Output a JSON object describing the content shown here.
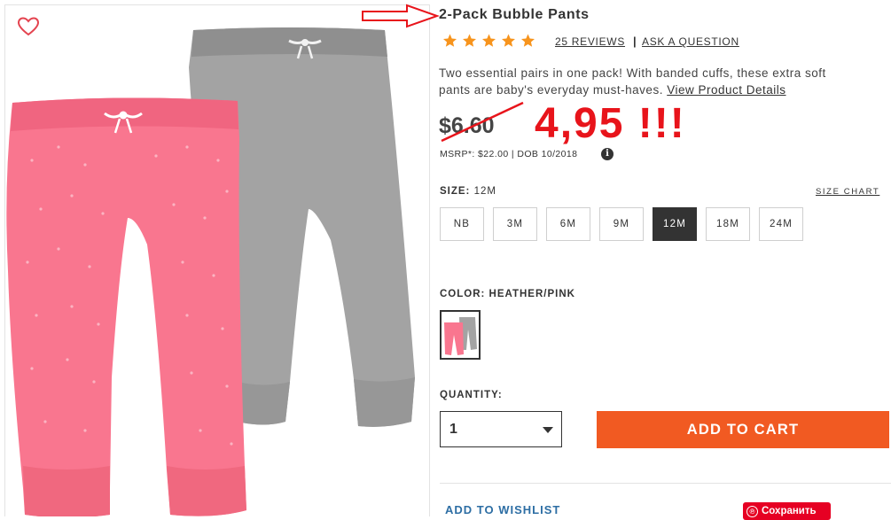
{
  "product": {
    "title": "2-Pack Bubble Pants",
    "rating_stars": 5,
    "reviews_link": "25 REVIEWS",
    "separator": "|",
    "ask_link": "ASK A QUESTION",
    "description": "Two essential pairs in one pack! With banded cuffs, these extra soft pants are baby's everyday must-haves.",
    "details_link": "View Product Details"
  },
  "price": {
    "old": "$6.60",
    "new": "4,95 !!!",
    "msrp": "MSRP*: $22.00 | DOB 10/2018",
    "info_glyph": "i"
  },
  "size": {
    "label": "SIZE:",
    "selected": "12M",
    "chart_link": "SIZE CHART",
    "options": [
      "NB",
      "3M",
      "6M",
      "9M",
      "12M",
      "18M",
      "24M"
    ]
  },
  "color": {
    "label": "COLOR: HEATHER/PINK"
  },
  "quantity": {
    "label": "QUANTITY:",
    "value": "1"
  },
  "actions": {
    "add_to_cart": "ADD TO CART",
    "add_to_wishlist": "ADD TO WISHLIST",
    "pinterest": "Сохранить",
    "pinterest_glyph": "℗"
  },
  "colors": {
    "accent": "#f15a22",
    "annotation": "#e8141b",
    "link": "#2d6ea4",
    "pink_pant": "#f9768f",
    "gray_pant": "#a3a3a3",
    "star": "#f7941d"
  },
  "icons": {
    "favorite": "heart-outline-icon",
    "star": "star-icon",
    "arrow": "red-arrow-annotation"
  }
}
